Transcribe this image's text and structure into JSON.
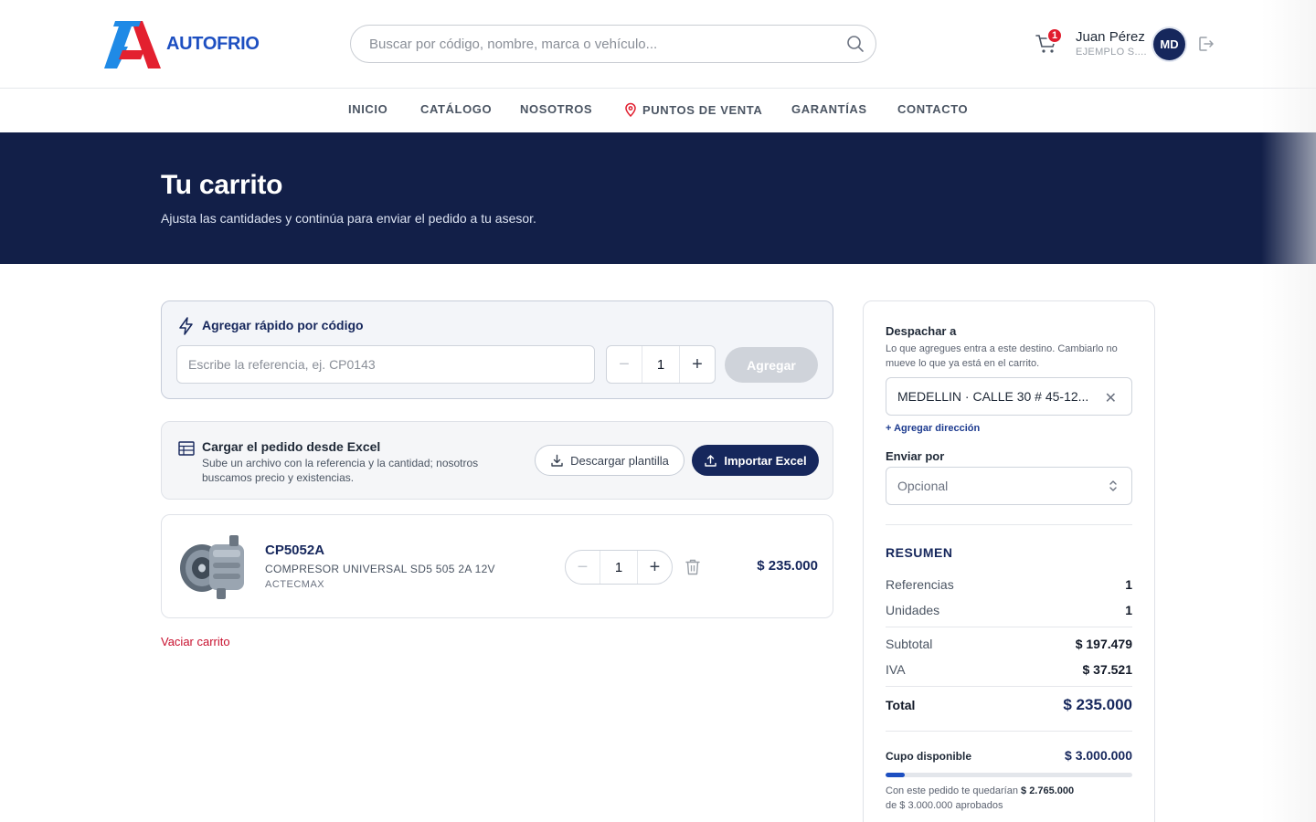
{
  "header": {
    "logo_text": "AUTOFRIO",
    "search_placeholder": "Buscar por código, nombre, marca o vehículo...",
    "cart_count": "1",
    "user_name": "Juan Pérez",
    "user_company": "EJEMPLO S....",
    "avatar_initials": "MD"
  },
  "nav": {
    "items": [
      "INICIO",
      "CATÁLOGO",
      "NOSOTROS",
      "PUNTOS DE VENTA",
      "GARANTÍAS",
      "CONTACTO"
    ]
  },
  "hero": {
    "title": "Tu carrito",
    "subtitle": "Ajusta las cantidades y continúa para enviar el pedido a tu asesor."
  },
  "quick_add": {
    "title": "Agregar rápido por código",
    "placeholder": "Escribe la referencia, ej. CP0143",
    "quantity": "1",
    "button": "Agregar"
  },
  "excel": {
    "title": "Cargar el pedido desde Excel",
    "description": "Sube un archivo con la referencia y la cantidad; nosotros buscamos precio y existencias.",
    "download_label": "Descargar plantilla",
    "import_label": "Importar Excel"
  },
  "cart_items": [
    {
      "code": "CP5052A",
      "description": "COMPRESOR UNIVERSAL SD5 505 2A 12V",
      "brand": "ACTECMAX",
      "quantity": "1",
      "price": "$ 235.000"
    }
  ],
  "empty_cart_label": "Vaciar carrito",
  "sidebar": {
    "ship_to_label": "Despachar a",
    "ship_to_help": "Lo que agregues entra a este destino. Cambiarlo no mueve lo que ya está en el carrito.",
    "address_value": "MEDELLIN · CALLE 30 # 45-12...",
    "add_address": "+ Agregar dirección",
    "send_by_label": "Enviar por",
    "send_by_placeholder": "Opcional",
    "summary_title": "RESUMEN",
    "references_label": "Referencias",
    "references_value": "1",
    "units_label": "Unidades",
    "units_value": "1",
    "subtotal_label": "Subtotal",
    "subtotal_value": "$ 197.479",
    "iva_label": "IVA",
    "iva_value": "$ 37.521",
    "total_label": "Total",
    "total_value": "$ 235.000",
    "credit_label": "Cupo disponible",
    "credit_value": "$ 3.000.000",
    "credit_used_fraction": 0.078,
    "credit_note_prefix": "Con este pedido te quedarían",
    "credit_remaining": "$ 2.765.000",
    "credit_note_suffix": "de $ 3.000.000 aprobados"
  },
  "colors": {
    "navy": "#16275c",
    "hero_bg": "#121f48",
    "accent_blue": "#1d4fc1",
    "danger_red": "#c8102e",
    "badge_red": "#e11d2e"
  }
}
